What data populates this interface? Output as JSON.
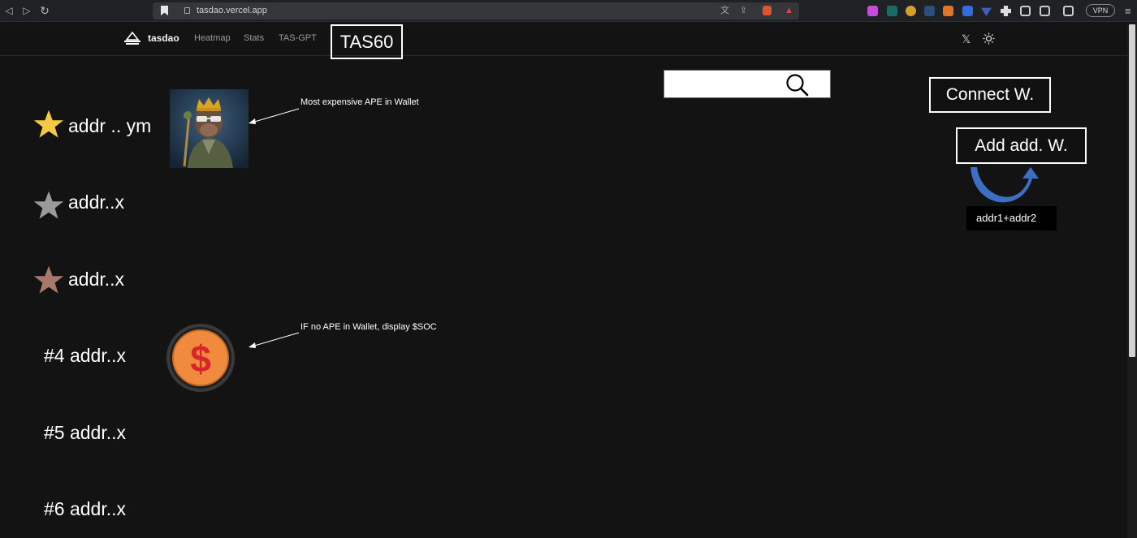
{
  "browser": {
    "url": "tasdao.vercel.app",
    "vpn_label": "VPN"
  },
  "header": {
    "brand": "tasdao",
    "nav": [
      "Heatmap",
      "Stats",
      "TAS-GPT"
    ],
    "tas60_label": "TAS60"
  },
  "search": {
    "value": "",
    "placeholder": ""
  },
  "wallet": {
    "connect_label": "Connect W.",
    "add_label": "Add add. W.",
    "combo_label": "addr1+addr2"
  },
  "leaderboard": [
    {
      "rank": "1",
      "medal": "gold",
      "name": "addr .. ym"
    },
    {
      "rank": "2",
      "medal": "silver",
      "name": "addr..x"
    },
    {
      "rank": "3",
      "medal": "bronze",
      "name": "addr..x"
    },
    {
      "rank": "4",
      "medal": "none",
      "name": "#4 addr..x"
    },
    {
      "rank": "5",
      "medal": "none",
      "name": "#5 addr..x"
    },
    {
      "rank": "6",
      "medal": "none",
      "name": "#6 addr..x"
    }
  ],
  "annotations": {
    "ape_note": "Most expensive APE in Wallet",
    "soc_note": "IF no APE in Wallet, display $SOC"
  },
  "colors": {
    "gold": "#f6c945",
    "silver": "#9a9a9a",
    "bronze": "#a8786a",
    "arrow_blue": "#3a6fc4",
    "coin_orange": "#f08a3c",
    "coin_red": "#d7262b"
  }
}
